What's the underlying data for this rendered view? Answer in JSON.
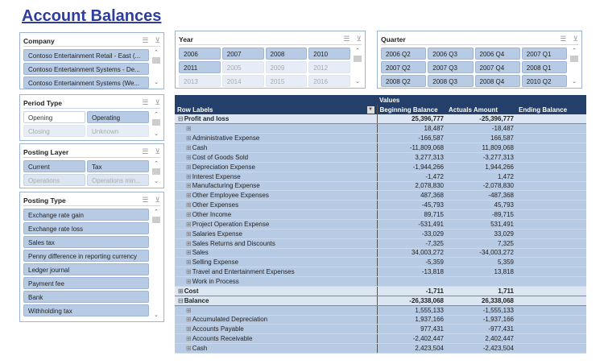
{
  "title": "Account Balances",
  "company": {
    "label": "Company",
    "items": [
      {
        "t": "Contoso Entertainment Retail - East (...",
        "s": "sel"
      },
      {
        "t": "Contoso Entertainment Systems - De...",
        "s": "sel"
      },
      {
        "t": "Contoso Entertainment Systems (We...",
        "s": "sel"
      }
    ]
  },
  "period_type": {
    "label": "Period Type",
    "items": [
      {
        "t": "Opening",
        "s": "un"
      },
      {
        "t": "Operating",
        "s": "sel"
      },
      {
        "t": "Closing",
        "s": "dis"
      },
      {
        "t": "Unknown",
        "s": "dis"
      }
    ]
  },
  "posting_layer": {
    "label": "Posting Layer",
    "items": [
      {
        "t": "Current",
        "s": "sel"
      },
      {
        "t": "Tax",
        "s": "sel"
      },
      {
        "t": "Operations",
        "s": "dissel"
      },
      {
        "t": "Operations min...",
        "s": "dissel"
      }
    ]
  },
  "posting_type": {
    "label": "Posting Type",
    "items": [
      {
        "t": "Exchange rate gain",
        "s": "sel"
      },
      {
        "t": "Exchange rate loss",
        "s": "sel"
      },
      {
        "t": "Sales tax",
        "s": "sel"
      },
      {
        "t": "Penny difference in reporting currency",
        "s": "sel"
      },
      {
        "t": "Ledger journal",
        "s": "sel"
      },
      {
        "t": "Payment fee",
        "s": "sel"
      },
      {
        "t": "Bank",
        "s": "sel"
      },
      {
        "t": "Withholding tax",
        "s": "sel"
      }
    ]
  },
  "year": {
    "label": "Year",
    "items": [
      {
        "t": "2006",
        "s": "sel"
      },
      {
        "t": "2007",
        "s": "sel"
      },
      {
        "t": "2008",
        "s": "sel"
      },
      {
        "t": "2010",
        "s": "sel"
      },
      {
        "t": "2011",
        "s": "sel"
      },
      {
        "t": "2005",
        "s": "dis"
      },
      {
        "t": "2009",
        "s": "dis"
      },
      {
        "t": "2012",
        "s": "dis"
      },
      {
        "t": "2013",
        "s": "dis"
      },
      {
        "t": "2014",
        "s": "dis"
      },
      {
        "t": "2015",
        "s": "dis"
      },
      {
        "t": "2016",
        "s": "dis"
      }
    ]
  },
  "quarter": {
    "label": "Quarter",
    "items": [
      {
        "t": "2006 Q2",
        "s": "sel"
      },
      {
        "t": "2006 Q3",
        "s": "sel"
      },
      {
        "t": "2006 Q4",
        "s": "sel"
      },
      {
        "t": "2007 Q1",
        "s": "sel"
      },
      {
        "t": "2007 Q2",
        "s": "sel"
      },
      {
        "t": "2007 Q3",
        "s": "sel"
      },
      {
        "t": "2007 Q4",
        "s": "sel"
      },
      {
        "t": "2008 Q1",
        "s": "sel"
      },
      {
        "t": "2008 Q2",
        "s": "sel"
      },
      {
        "t": "2008 Q3",
        "s": "sel"
      },
      {
        "t": "2008 Q4",
        "s": "sel"
      },
      {
        "t": "2010 Q2",
        "s": "sel"
      }
    ]
  },
  "pivot": {
    "values_label": "Values",
    "row_labels": "Row Labels",
    "columns": [
      "Beginning Balance",
      "Actuals Amount",
      "Ending Balance"
    ],
    "rows": [
      {
        "l": "Profit and loss",
        "g": "minus",
        "b": "25,396,777",
        "a": "-25,396,777"
      },
      {
        "l": "",
        "b": "18,487",
        "a": "-18,487"
      },
      {
        "l": "Administrative Expense",
        "b": "-166,587",
        "a": "166,587"
      },
      {
        "l": "Cash",
        "b": "-11,809,068",
        "a": "11,809,068"
      },
      {
        "l": "Cost of Goods Sold",
        "b": "3,277,313",
        "a": "-3,277,313"
      },
      {
        "l": "Depreciation Expense",
        "b": "-1,944,266",
        "a": "1,944,266"
      },
      {
        "l": "Interest Expense",
        "b": "-1,472",
        "a": "1,472"
      },
      {
        "l": "Manufacturing Expense",
        "b": "2,078,830",
        "a": "-2,078,830"
      },
      {
        "l": "Other Employee Expenses",
        "b": "487,368",
        "a": "-487,368"
      },
      {
        "l": "Other Expenses",
        "b": "-45,793",
        "a": "45,793"
      },
      {
        "l": "Other Income",
        "b": "89,715",
        "a": "-89,715"
      },
      {
        "l": "Project Operation Expense",
        "b": "-531,491",
        "a": "531,491"
      },
      {
        "l": "Salaries Expense",
        "b": "-33,029",
        "a": "33,029"
      },
      {
        "l": "Sales Returns and Discounts",
        "b": "-7,325",
        "a": "7,325"
      },
      {
        "l": "Sales",
        "b": "34,003,272",
        "a": "-34,003,272"
      },
      {
        "l": "Selling Expense",
        "b": "-5,359",
        "a": "5,359"
      },
      {
        "l": "Travel and Entertainment Expenses",
        "b": "-13,818",
        "a": "13,818"
      },
      {
        "l": "Work in Process",
        "b": "",
        "a": ""
      },
      {
        "l": "Cost",
        "g": "plus",
        "b": "-1,711",
        "a": "1,711"
      },
      {
        "l": "Balance",
        "g": "minus",
        "b": "-26,338,068",
        "a": "26,338,068"
      },
      {
        "l": "",
        "b": "1,555,133",
        "a": "-1,555,133"
      },
      {
        "l": "Accumulated Depreciation",
        "b": "1,937,166",
        "a": "-1,937,166"
      },
      {
        "l": "Accounts Payable",
        "b": "977,431",
        "a": "-977,431"
      },
      {
        "l": "Accounts Receivable",
        "b": "-2,402,447",
        "a": "2,402,447"
      },
      {
        "l": "Cash",
        "b": "2,423,504",
        "a": "-2,423,504"
      }
    ]
  }
}
